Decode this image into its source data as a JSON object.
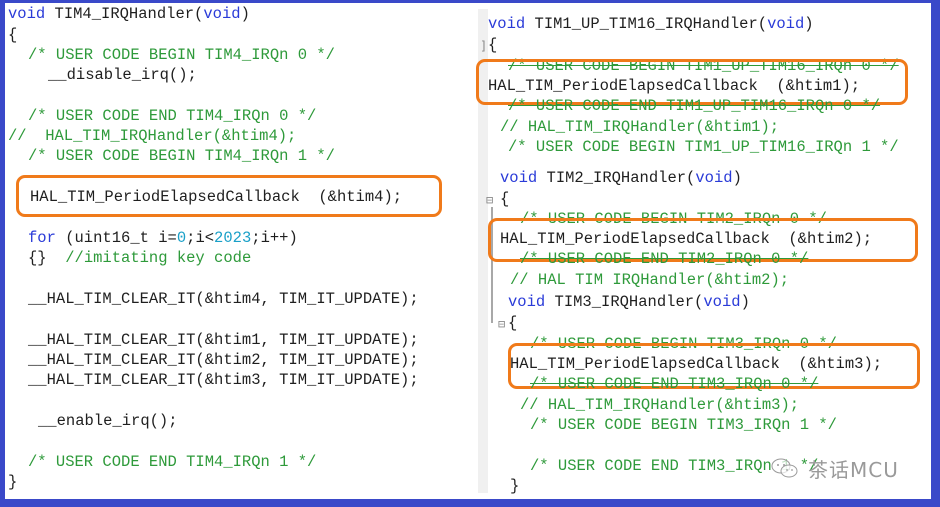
{
  "left_panel": {
    "lines": [
      {
        "kw1": "void",
        "text": " TIM4_IRQHandler(",
        "kw2": "void",
        "end": ")"
      },
      {
        "text": "{"
      },
      {
        "comment": "/* USER CODE BEGIN TIM4_IRQn 0 */"
      },
      {
        "text": "__disable_irq();"
      },
      {
        "comment": "/* USER CODE END TIM4_IRQn 0 */"
      },
      {
        "comment": "//  HAL_TIM_IRQHandler(&htim4);"
      },
      {
        "comment": "/* USER CODE BEGIN TIM4_IRQn 1 */"
      },
      {
        "text": "HAL_TIM_PeriodElapsedCallback  (&htim4);",
        "highlighted": true
      },
      {
        "kw1": "for",
        "text_a": " (uint16_t i=",
        "num1": "0",
        "text_b": ";i<",
        "num2": "2023",
        "text_c": ";i++)"
      },
      {
        "text": "{}",
        "comment": "  //imitating key code"
      },
      {
        "text": "__HAL_TIM_CLEAR_IT(&htim4, TIM_IT_UPDATE);"
      },
      {
        "text": "__HAL_TIM_CLEAR_IT(&htim1, TIM_IT_UPDATE);"
      },
      {
        "text": "__HAL_TIM_CLEAR_IT(&htim2, TIM_IT_UPDATE);"
      },
      {
        "text": "__HAL_TIM_CLEAR_IT(&htim3, TIM_IT_UPDATE);"
      },
      {
        "text": "__enable_irq();"
      },
      {
        "comment": "/* USER CODE END TIM4_IRQn 1 */"
      },
      {
        "text": "}"
      }
    ]
  },
  "right_panel": {
    "tim1": {
      "signature_kw": "void",
      "signature": " TIM1_UP_TIM16_IRQHandler(",
      "signature_kw2": "void",
      "signature_end": ")",
      "open": "{",
      "begin0": "/* USER CODE BEGIN TIM1_UP_TIM16_IRQn 0 */",
      "callback": "HAL_TIM_PeriodElapsedCallback  (&htim1);",
      "end0": "/* USER CODE END TIM1_UP_TIM16_IRQn 0 */",
      "irq": "// HAL_TIM_IRQHandler(&htim1);",
      "begin1": "/* USER CODE BEGIN TIM1_UP_TIM16_IRQn 1 */"
    },
    "tim2": {
      "signature_kw": "void",
      "signature": " TIM2_IRQHandler(",
      "signature_kw2": "void",
      "signature_end": ")",
      "open": "{",
      "begin0": "/* USER CODE BEGIN TIM2_IRQn 0 */",
      "callback": "HAL_TIM_PeriodElapsedCallback  (&htim2);",
      "end0": "/* USER CODE END TIM2_IRQn 0 */",
      "irq": "// HAL TIM IRQHandler(&htim2);"
    },
    "tim3": {
      "signature_kw": "void",
      "signature": " TIM3_IRQHandler(",
      "signature_kw2": "void",
      "signature_end": ")",
      "open": "{",
      "begin0": "/* USER CODE BEGIN TIM3_IRQn 0 */",
      "callback": "HAL_TIM_PeriodElapsedCallback  (&htim3);",
      "end0": "/* USER CODE END TIM3_IRQn 0 */",
      "irq": "// HAL_TIM_IRQHandler(&htim3);",
      "begin1": "/* USER CODE BEGIN TIM3_IRQn 1 */",
      "end1": "/* USER CODE END TIM3_IRQn 1 */",
      "close": "}"
    }
  },
  "watermark": {
    "text": "茶话MCU",
    "icon": "wechat-icon"
  },
  "colors": {
    "border": "#3a49c9",
    "highlight": "#f07a1a",
    "keyword": "#2a3bd8",
    "comment": "#2e9a3a",
    "number": "#1aa0c8"
  }
}
